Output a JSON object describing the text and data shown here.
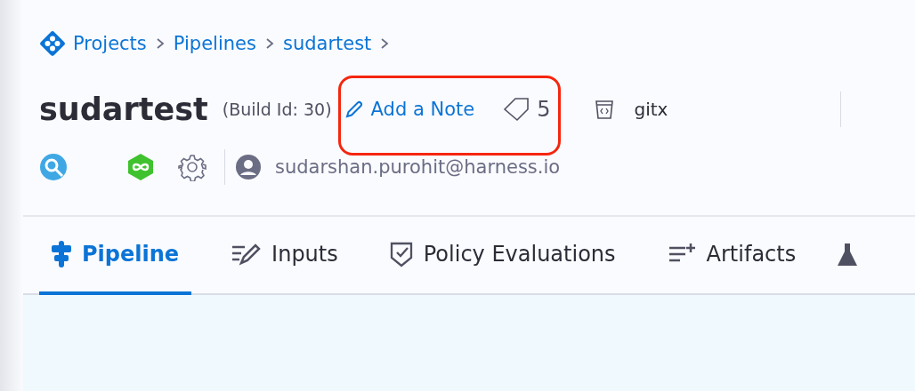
{
  "breadcrumbs": [
    "Projects",
    "Pipelines",
    "sudartest"
  ],
  "header": {
    "title": "sudartest",
    "build_id": "(Build Id: 30)",
    "note_link": "Add a Note",
    "tag_count": "5",
    "repo": "gitx",
    "highlighted": true
  },
  "user": {
    "email": "sudarshan.purohit@harness.io"
  },
  "tabs": [
    {
      "label": "Pipeline",
      "selected": true,
      "kind": "pipeline"
    },
    {
      "label": "Inputs",
      "selected": false,
      "kind": "inputs"
    },
    {
      "label": "Policy Evaluations",
      "selected": false,
      "kind": "policy"
    },
    {
      "label": "Artifacts",
      "selected": false,
      "kind": "artifacts"
    }
  ]
}
